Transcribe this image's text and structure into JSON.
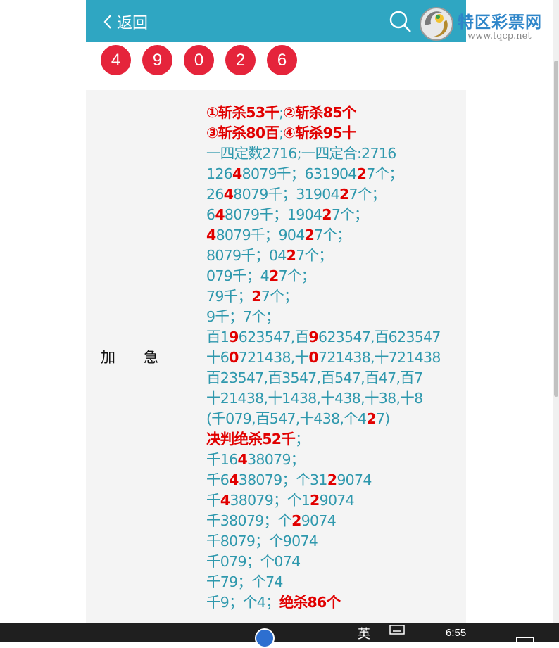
{
  "header": {
    "back_label": "返回",
    "brand_name": "特区彩票网",
    "brand_url": "www.tqcp.net"
  },
  "numbers": [
    "4",
    "9",
    "0",
    "2",
    "6"
  ],
  "row": {
    "label": "加急",
    "lines": [
      [
        {
          "t": "①斩杀53千",
          "r": true
        },
        {
          "t": ";"
        },
        {
          "t": "②斩杀85个",
          "r": true
        }
      ],
      [
        {
          "t": "③斩杀80百",
          "r": true
        },
        {
          "t": ";"
        },
        {
          "t": "④斩杀95十",
          "r": true
        }
      ],
      [
        {
          "t": "一四定数2716;一四定合:2716"
        }
      ],
      [
        {
          "t": "126"
        },
        {
          "t": "4",
          "r": true
        },
        {
          "t": "8079千；631904"
        },
        {
          "t": "2",
          "r": true
        },
        {
          "t": "7个；"
        }
      ],
      [
        {
          "t": "26"
        },
        {
          "t": "4",
          "r": true
        },
        {
          "t": "8079千；31904"
        },
        {
          "t": "2",
          "r": true
        },
        {
          "t": "7个；"
        }
      ],
      [
        {
          "t": "6"
        },
        {
          "t": "4",
          "r": true
        },
        {
          "t": "8079千；1904"
        },
        {
          "t": "2",
          "r": true
        },
        {
          "t": "7个；"
        }
      ],
      [
        {
          "t": "4",
          "r": true
        },
        {
          "t": "8079千；904"
        },
        {
          "t": "2",
          "r": true
        },
        {
          "t": "7个；"
        }
      ],
      [
        {
          "t": "8079千；04"
        },
        {
          "t": "2",
          "r": true
        },
        {
          "t": "7个；"
        }
      ],
      [
        {
          "t": "079千；4"
        },
        {
          "t": "2",
          "r": true
        },
        {
          "t": "7个；"
        }
      ],
      [
        {
          "t": "79千；"
        },
        {
          "t": "2",
          "r": true
        },
        {
          "t": "7个；"
        }
      ],
      [
        {
          "t": "9千；7个；"
        }
      ],
      [
        {
          "t": "百1"
        },
        {
          "t": "9",
          "r": true
        },
        {
          "t": "623547,百"
        },
        {
          "t": "9",
          "r": true
        },
        {
          "t": "623547,百623547"
        }
      ],
      [
        {
          "t": "十6"
        },
        {
          "t": "0",
          "r": true
        },
        {
          "t": "721438,十"
        },
        {
          "t": "0",
          "r": true
        },
        {
          "t": "721438,十721438"
        }
      ],
      [
        {
          "t": "百23547,百3547,百547,百47,百7"
        }
      ],
      [
        {
          "t": "十21438,十1438,十438,十38,十8"
        }
      ],
      [
        {
          "t": "(千079,百547,十438,个4"
        },
        {
          "t": "2",
          "r": true
        },
        {
          "t": "7)"
        }
      ],
      [
        {
          "t": "决判绝杀52千",
          "r": true
        },
        {
          "t": "；"
        }
      ],
      [
        {
          "t": "千16"
        },
        {
          "t": "4",
          "r": true
        },
        {
          "t": "38079；"
        }
      ],
      [
        {
          "t": "千6"
        },
        {
          "t": "4",
          "r": true
        },
        {
          "t": "38079；个31"
        },
        {
          "t": "2",
          "r": true
        },
        {
          "t": "9074"
        }
      ],
      [
        {
          "t": "千"
        },
        {
          "t": "4",
          "r": true
        },
        {
          "t": "38079；个1"
        },
        {
          "t": "2",
          "r": true
        },
        {
          "t": "9074"
        }
      ],
      [
        {
          "t": "千38079；个"
        },
        {
          "t": "2",
          "r": true
        },
        {
          "t": "9074"
        }
      ],
      [
        {
          "t": "千8079；个9074"
        }
      ],
      [
        {
          "t": "千079；个074"
        }
      ],
      [
        {
          "t": "千79；个74"
        }
      ],
      [
        {
          "t": "千9；个4；"
        },
        {
          "t": "绝杀86个",
          "r": true
        }
      ]
    ]
  },
  "taskbar": {
    "time": "6:55",
    "ime_label": "英"
  },
  "colors": {
    "header_bg": "#2fa6c2",
    "ball": "#e5243b",
    "text": "#2e98ad",
    "highlight": "#e10000"
  }
}
